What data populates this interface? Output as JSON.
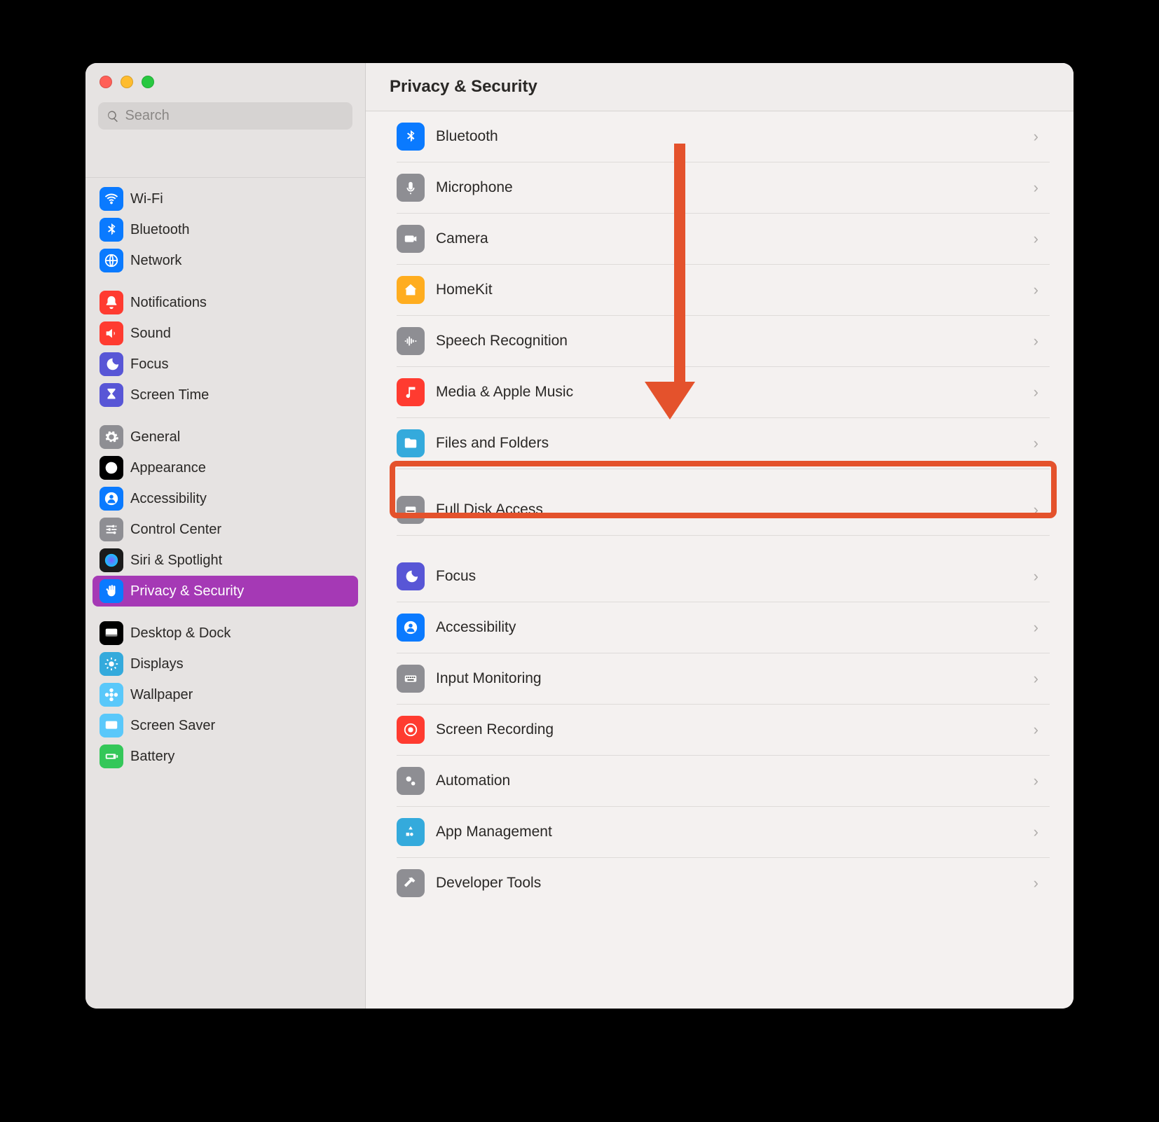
{
  "header": {
    "title": "Privacy & Security"
  },
  "search": {
    "placeholder": "Search"
  },
  "sidebar": {
    "groups": [
      [
        {
          "label": "Wi-Fi",
          "icon": "wifi",
          "bg": "#0a7aff"
        },
        {
          "label": "Bluetooth",
          "icon": "bluetooth",
          "bg": "#0a7aff"
        },
        {
          "label": "Network",
          "icon": "globe",
          "bg": "#0a7aff"
        }
      ],
      [
        {
          "label": "Notifications",
          "icon": "bell",
          "bg": "#ff3b30"
        },
        {
          "label": "Sound",
          "icon": "speaker",
          "bg": "#ff3b30"
        },
        {
          "label": "Focus",
          "icon": "moon",
          "bg": "#5856d6"
        },
        {
          "label": "Screen Time",
          "icon": "hourglass",
          "bg": "#5856d6"
        }
      ],
      [
        {
          "label": "General",
          "icon": "gear",
          "bg": "#8e8e93"
        },
        {
          "label": "Appearance",
          "icon": "appearance",
          "bg": "#000000"
        },
        {
          "label": "Accessibility",
          "icon": "person",
          "bg": "#0a7aff"
        },
        {
          "label": "Control Center",
          "icon": "sliders",
          "bg": "#8e8e93"
        },
        {
          "label": "Siri & Spotlight",
          "icon": "siri",
          "bg": "#1b1b1b"
        },
        {
          "label": "Privacy & Security",
          "icon": "hand",
          "bg": "#0a7aff",
          "selected": true
        }
      ],
      [
        {
          "label": "Desktop & Dock",
          "icon": "dock",
          "bg": "#000000"
        },
        {
          "label": "Displays",
          "icon": "sun",
          "bg": "#34aadc"
        },
        {
          "label": "Wallpaper",
          "icon": "flower",
          "bg": "#5ac8fa"
        },
        {
          "label": "Screen Saver",
          "icon": "screensaver",
          "bg": "#5ac8fa"
        },
        {
          "label": "Battery",
          "icon": "battery",
          "bg": "#34c759"
        }
      ]
    ]
  },
  "main": {
    "rows": [
      {
        "label": "Bluetooth",
        "icon": "bluetooth",
        "bg": "#0a7aff"
      },
      {
        "label": "Microphone",
        "icon": "mic",
        "bg": "#8e8e93"
      },
      {
        "label": "Camera",
        "icon": "camera",
        "bg": "#8e8e93"
      },
      {
        "label": "HomeKit",
        "icon": "home",
        "bg": "#ffad1f"
      },
      {
        "label": "Speech Recognition",
        "icon": "wave",
        "bg": "#8e8e93"
      },
      {
        "label": "Media & Apple Music",
        "icon": "music",
        "bg": "#ff3b30"
      },
      {
        "label": "Files and Folders",
        "icon": "folder",
        "bg": "#34aadc"
      },
      {
        "gap": true
      },
      {
        "label": "Full Disk Access",
        "icon": "disk",
        "bg": "#8e8e93",
        "highlighted": true
      },
      {
        "gap": true
      },
      {
        "label": "Focus",
        "icon": "moon",
        "bg": "#5856d6"
      },
      {
        "label": "Accessibility",
        "icon": "person",
        "bg": "#0a7aff"
      },
      {
        "label": "Input Monitoring",
        "icon": "keyboard",
        "bg": "#8e8e93"
      },
      {
        "label": "Screen Recording",
        "icon": "record",
        "bg": "#ff3b30"
      },
      {
        "label": "Automation",
        "icon": "gears",
        "bg": "#8e8e93"
      },
      {
        "label": "App Management",
        "icon": "apps",
        "bg": "#34aadc"
      },
      {
        "label": "Developer Tools",
        "icon": "hammer",
        "bg": "#8e8e93"
      }
    ]
  },
  "annotation": {
    "arrow_color": "#e4522c",
    "highlight_color": "#e4522c"
  }
}
